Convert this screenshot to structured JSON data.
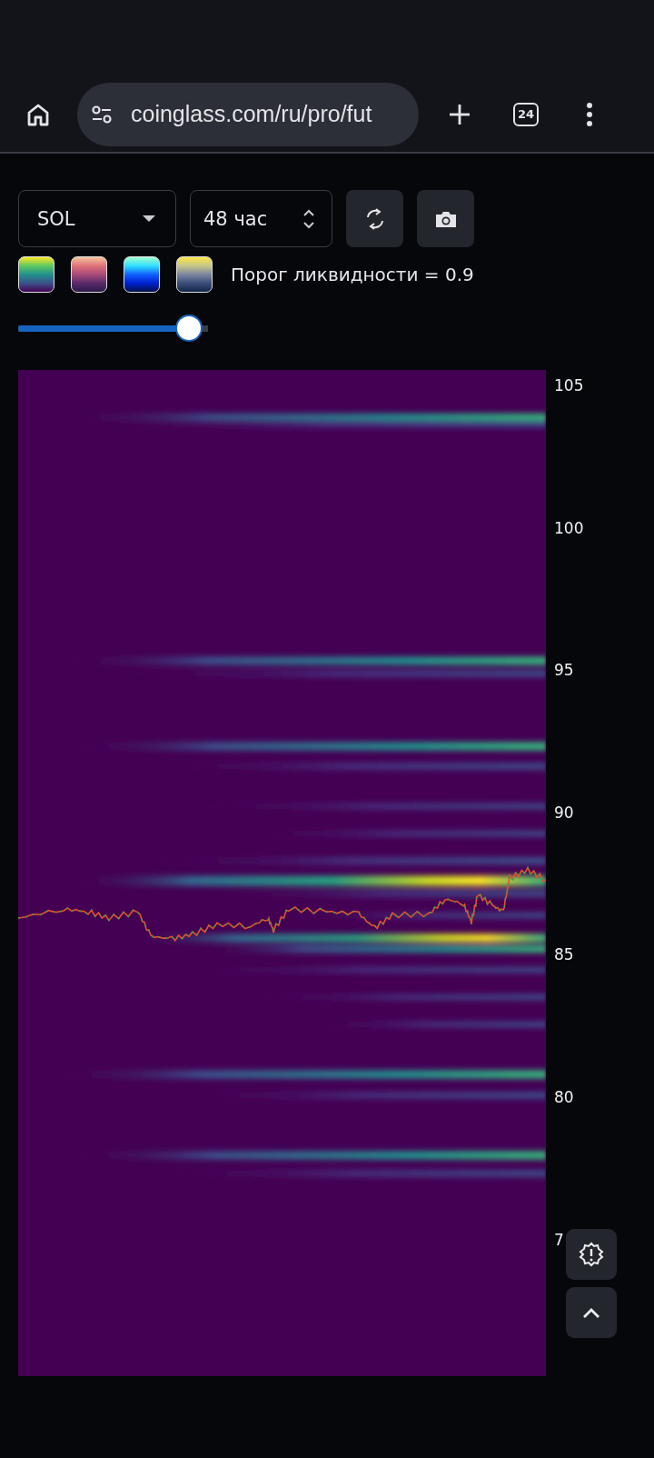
{
  "browser": {
    "url": "coinglass.com/ru/pro/fut",
    "tab_count": "24"
  },
  "controls": {
    "symbol": "SOL",
    "period": "48 час"
  },
  "palettes": [
    {
      "kind": "viridis"
    },
    {
      "kind": "sunset"
    },
    {
      "kind": "spectral"
    },
    {
      "kind": "cividis"
    }
  ],
  "threshold": {
    "label": "Порог ликвидности = 0.9",
    "level": 0.9
  },
  "chart": {
    "price_labels": [
      "105",
      "100",
      "95",
      "90",
      "85",
      "80",
      "7"
    ]
  }
}
